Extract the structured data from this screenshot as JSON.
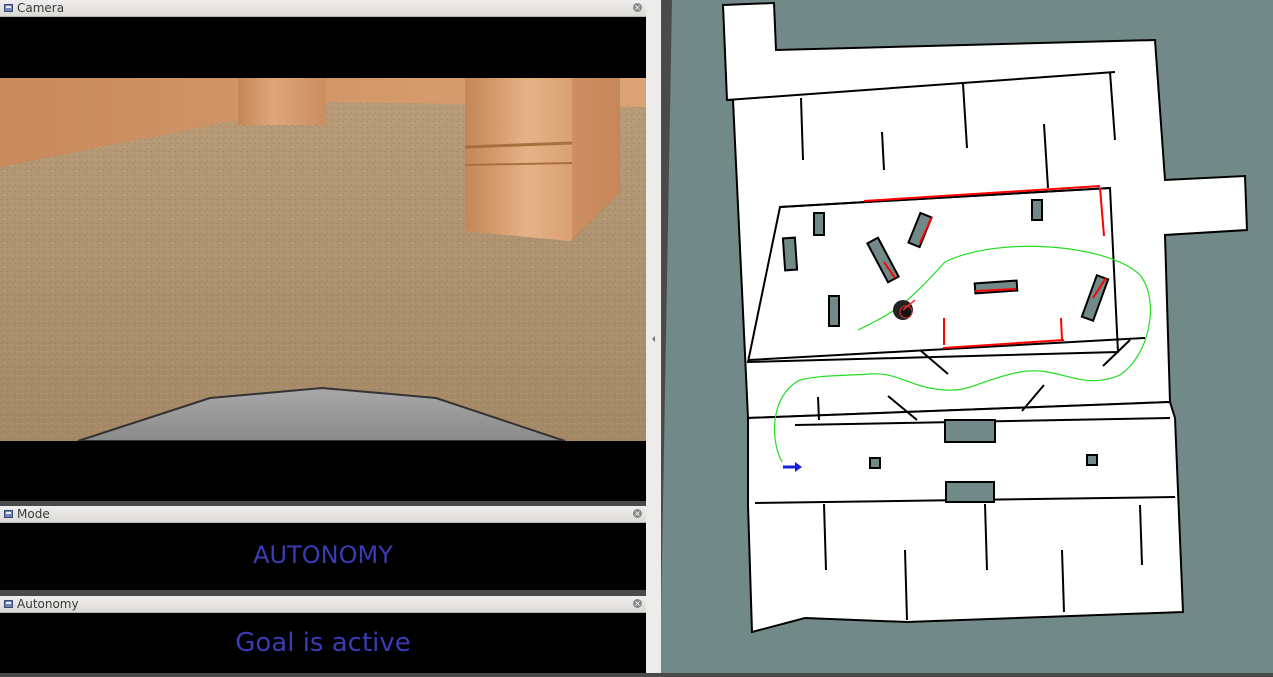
{
  "panels": {
    "camera": {
      "title": "Camera"
    },
    "mode": {
      "title": "Mode",
      "text": "AUTONOMY"
    },
    "autonomy": {
      "title": "Autonomy",
      "text": "Goal is active"
    }
  },
  "icons": {
    "window": "window-icon",
    "close": "close-icon",
    "splitter_arrow": "chevron-left-icon",
    "goal_arrow": "arrow-right-icon"
  },
  "colors": {
    "status_text": "#3b3bb6",
    "map_unknown": "#728a87",
    "map_free": "#ffffff",
    "map_obstacle": "#000000",
    "costmap_edge": "#ff0000",
    "planned_path": "#22dd22",
    "goal_arrow": "#1020dd"
  }
}
